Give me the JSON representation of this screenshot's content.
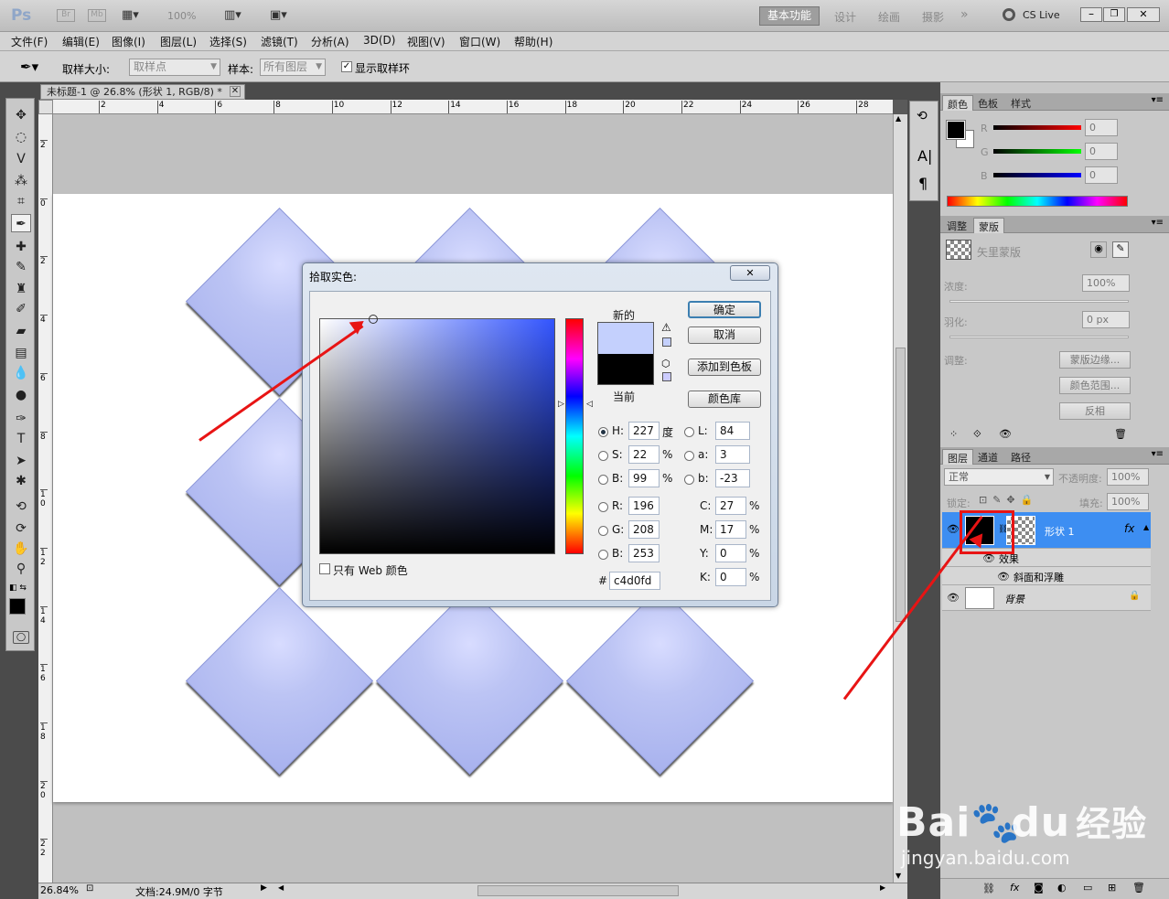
{
  "appbar": {
    "logo": "Ps",
    "br": "Br",
    "mb": "Mb",
    "zoom": "100%",
    "workspaces": [
      "基本功能",
      "设计",
      "绘画",
      "摄影"
    ],
    "more": "»",
    "cslive": "CS Live"
  },
  "menubar": {
    "items": [
      "文件(F)",
      "编辑(E)",
      "图像(I)",
      "图层(L)",
      "选择(S)",
      "滤镜(T)",
      "分析(A)",
      "3D(D)",
      "视图(V)",
      "窗口(W)",
      "帮助(H)"
    ]
  },
  "options": {
    "sample_size_label": "取样大小:",
    "sample_size_value": "取样点",
    "sample_label": "样本:",
    "sample_value": "所有图层",
    "show_ring_label": "显示取样环",
    "show_ring_checked": true
  },
  "document": {
    "tab_title": "未标题-1 @ 26.8% (形状 1, RGB/8) *",
    "ruler_h": [
      "2",
      "4",
      "6",
      "8",
      "10",
      "12",
      "14",
      "16",
      "18",
      "20",
      "22",
      "24",
      "26",
      "28"
    ],
    "ruler_v": [
      "2",
      "0",
      "2",
      "4",
      "6",
      "8",
      "1 0",
      "1 2",
      "1 4",
      "1 6",
      "1 8",
      "2 0",
      "2 2"
    ],
    "tile_color": "#c4d0fd"
  },
  "status": {
    "zoom": "26.84%",
    "doc_info": "文档:24.9M/0 字节"
  },
  "color_picker": {
    "title": "拾取实色:",
    "new_label": "新的",
    "current_label": "当前",
    "new_color": "#c4d0fd",
    "current_color": "#000000",
    "buttons": {
      "ok": "确定",
      "cancel": "取消",
      "add_swatch": "添加到色板",
      "libraries": "颜色库"
    },
    "web_only_label": "只有 Web 颜色",
    "hsb": {
      "h": "227",
      "h_unit": "度",
      "s": "22",
      "s_unit": "%",
      "b": "99",
      "b_unit": "%"
    },
    "rgb": {
      "r": "196",
      "g": "208",
      "b": "253"
    },
    "lab": {
      "l": "84",
      "a": "3",
      "b": "-23"
    },
    "cmyk": {
      "c": "27",
      "m": "17",
      "y": "0",
      "k": "0",
      "unit": "%"
    },
    "hex": "c4d0fd",
    "labels": {
      "H": "H:",
      "S": "S:",
      "B": "B:",
      "R": "R:",
      "G": "G:",
      "B2": "B:",
      "L": "L:",
      "a": "a:",
      "b": "b:",
      "C": "C:",
      "M": "M:",
      "Y": "Y:",
      "K": "K:",
      "hash": "#"
    }
  },
  "color_panel": {
    "tabs": [
      "颜色",
      "色板",
      "样式"
    ],
    "r_label": "R",
    "g_label": "G",
    "b_label": "B",
    "r": "0",
    "g": "0",
    "b": "0"
  },
  "masks_panel": {
    "tabs": [
      "调整",
      "蒙版"
    ],
    "title": "矢里蒙版",
    "density_label": "浓度:",
    "density": "100%",
    "feather_label": "羽化:",
    "feather": "0 px",
    "refine_label": "调整:",
    "btn_edge": "蒙版边缘...",
    "btn_range": "颜色范围...",
    "btn_invert": "反相"
  },
  "layers_panel": {
    "tabs": [
      "图层",
      "通道",
      "路径"
    ],
    "blend": "正常",
    "opacity_label": "不透明度:",
    "opacity": "100%",
    "lock_label": "锁定:",
    "fill_label": "填充:",
    "fill": "100%",
    "layers": [
      {
        "name": "形状 1",
        "selected": true
      },
      {
        "name": "效果",
        "indent": 1
      },
      {
        "name": "斜面和浮雕",
        "indent": 2
      },
      {
        "name": "背景",
        "locked": true
      }
    ]
  },
  "watermark": {
    "brand": "Bai",
    "brand2": "du",
    "jy": "经验",
    "url": "jingyan.baidu.com"
  },
  "colors": {
    "highlight": "#e81414",
    "selected_layer": "#3d8ef2"
  }
}
